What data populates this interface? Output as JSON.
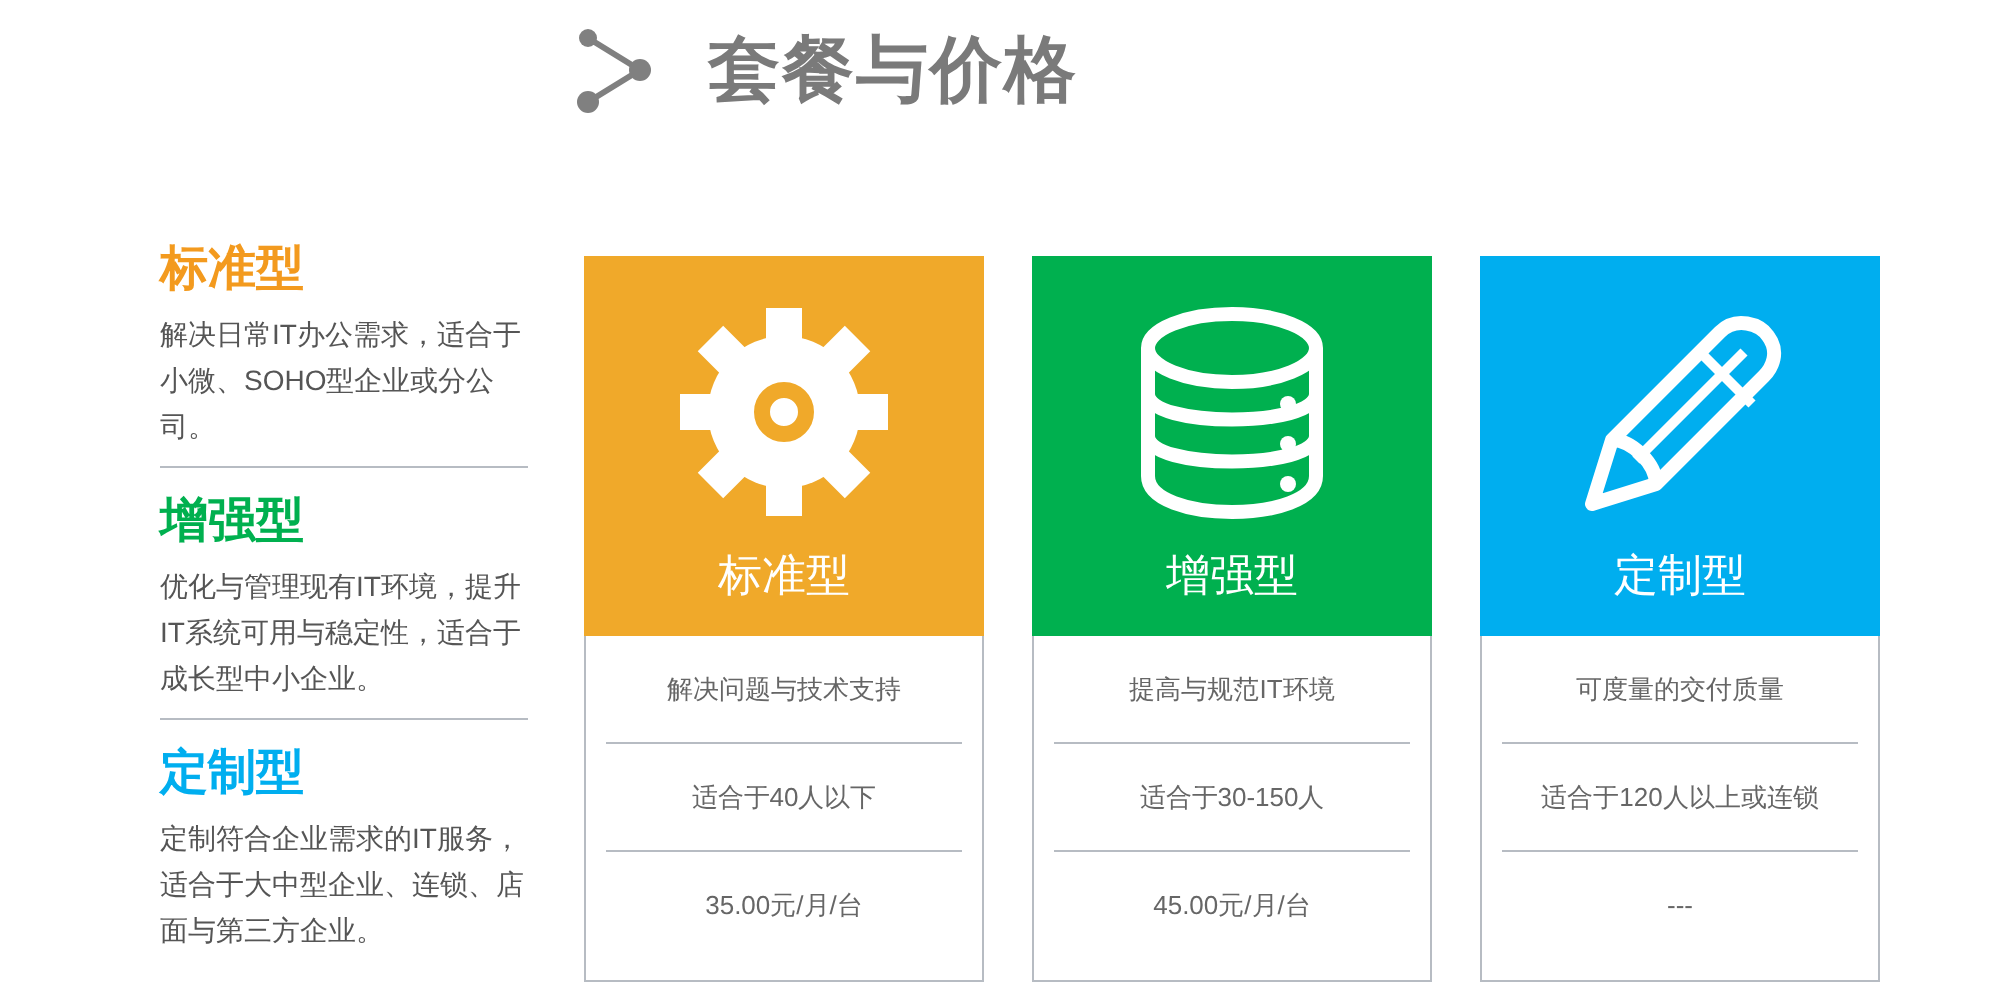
{
  "header": {
    "title": "套餐与价格"
  },
  "plans": [
    {
      "name": "标准型",
      "color": "#f39a1e",
      "description": "解决日常IT办公需求，适合于小微、SOHO型企业或分公司。"
    },
    {
      "name": "增强型",
      "color": "#00b04f",
      "description": "优化与管理现有IT环境，提升IT系统可用与稳定性，适合于成长型中小企业。"
    },
    {
      "name": "定制型",
      "color": "#00aeef",
      "description": "定制符合企业需求的IT服务，适合于大中型企业、连锁、店面与第三方企业。"
    }
  ],
  "cards": [
    {
      "kind": "gear",
      "name": "标准型",
      "color": "#f0a92a",
      "features": [
        "解决问题与技术支持",
        "适合于40人以下",
        "35.00元/月/台"
      ]
    },
    {
      "kind": "database",
      "name": "增强型",
      "color": "#00b04f",
      "features": [
        "提高与规范IT环境",
        "适合于30-150人",
        "45.00元/月/台"
      ]
    },
    {
      "kind": "pencil",
      "name": "定制型",
      "color": "#00aeef",
      "features": [
        "可度量的交付质量",
        "适合于120人以上或连锁",
        "---"
      ]
    }
  ]
}
